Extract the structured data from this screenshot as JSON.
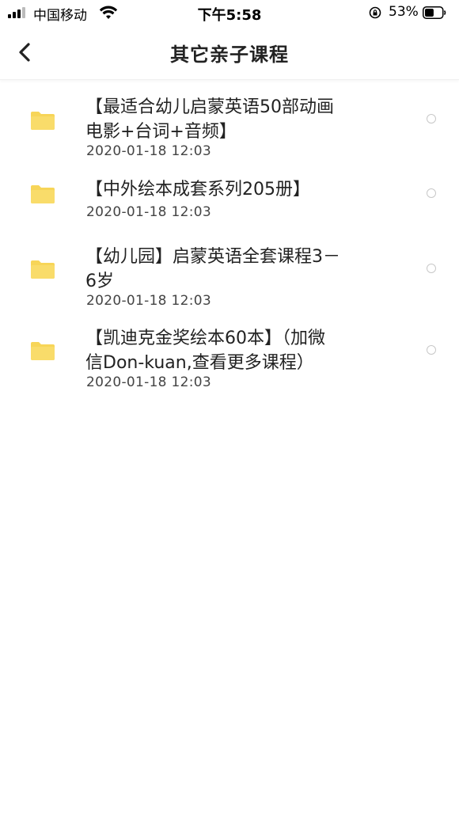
{
  "status_bar": {
    "carrier": "中国移动",
    "time": "下午5:58",
    "battery_percent": "53%",
    "battery_level": 0.53
  },
  "nav": {
    "back_icon": "chevron-left-icon",
    "title": "其它亲子课程"
  },
  "colors": {
    "folder": "#F7D558",
    "radio_border": "#C8C8C8"
  },
  "items": [
    {
      "title": "【最适合幼儿启蒙英语50部动画\n电影+台词+音频】",
      "date": "2020-01-18 12:03",
      "icon": "folder-icon",
      "selected": false
    },
    {
      "title": "【中外绘本成套系列205册】",
      "date": "2020-01-18 12:03",
      "icon": "folder-icon",
      "selected": false
    },
    {
      "title": "【幼儿园】启蒙英语全套课程3－\n6岁",
      "date": "2020-01-18 12:03",
      "icon": "folder-icon",
      "selected": false
    },
    {
      "title": "【凯迪克金奖绘本60本】（加微\n信Don-kuan,查看更多课程）",
      "date": "2020-01-18 12:03",
      "icon": "folder-icon",
      "selected": false
    }
  ]
}
